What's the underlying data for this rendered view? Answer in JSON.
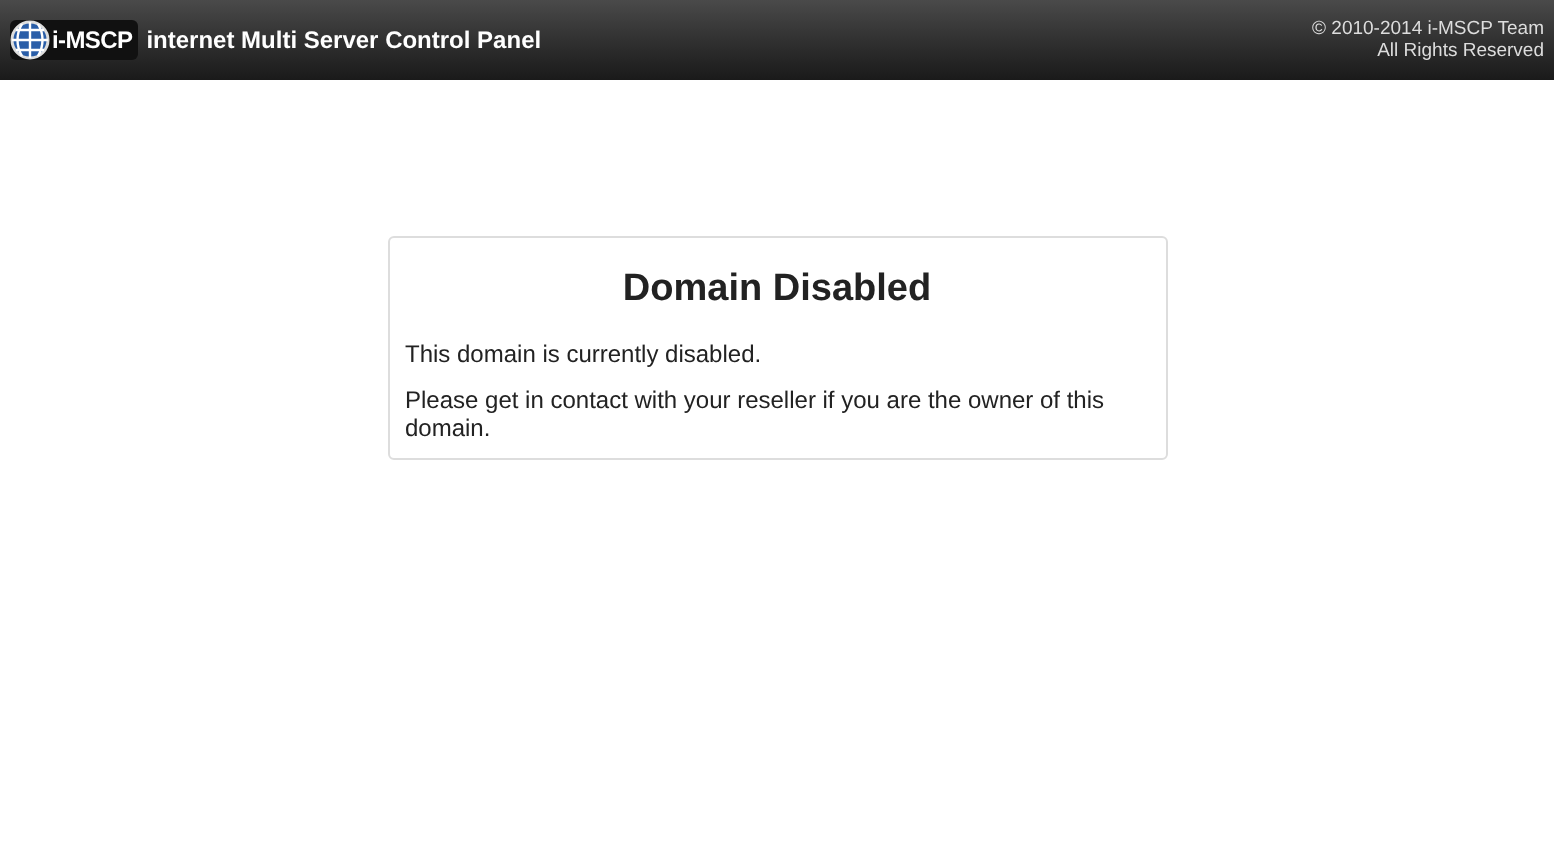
{
  "header": {
    "logo_text": "i-MSCP",
    "title": "internet Multi Server Control Panel",
    "copyright": "© 2010-2014 i-MSCP Team",
    "rights": "All Rights Reserved"
  },
  "message": {
    "title": "Domain Disabled",
    "paragraphs": [
      "This domain is currently disabled.",
      "Please get in contact with your reseller if you are the owner of this domain."
    ]
  }
}
